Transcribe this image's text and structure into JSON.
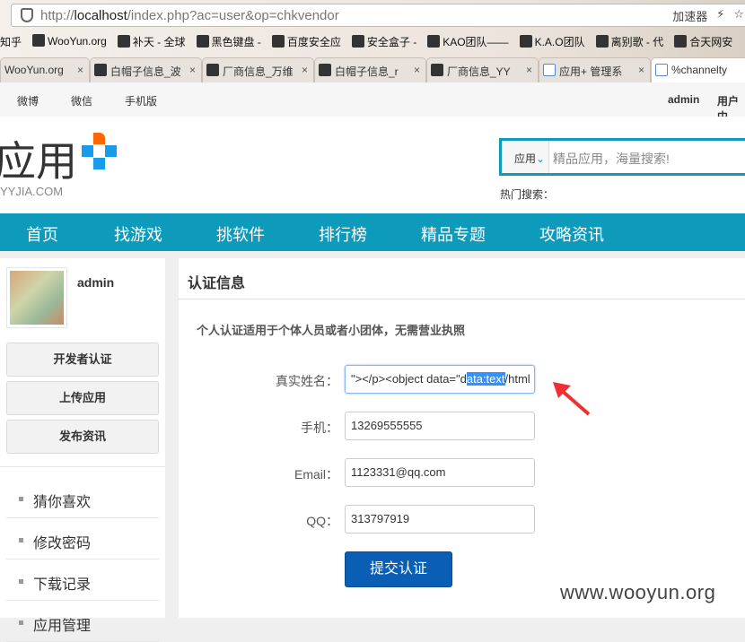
{
  "browser": {
    "url_prefix": "http://",
    "url_host": "localhost",
    "url_path": "/index.php?ac=user&op=chkvendor",
    "accelerator": "加速器",
    "bookmarks": [
      "知乎",
      "WooYun.org",
      "补天 - 全球",
      "黑色键盘 -",
      "百度安全应",
      "安全盒子 -",
      "KAO团队——",
      "K.A.O团队",
      "离别歌 - 代",
      "合天网安"
    ],
    "tabs": [
      "WooYun.org",
      "白帽子信息_波",
      "厂商信息_万维",
      "白帽子信息_r",
      "厂商信息_YY",
      "应用+ 管理系",
      "%channelty"
    ]
  },
  "topbar": {
    "links": [
      "微博",
      "微信",
      "手机版"
    ],
    "user": "admin",
    "user_center": "用户中"
  },
  "header": {
    "logo_text": "应用",
    "logo_sub": "YYJIA.COM",
    "search_category": "应用",
    "search_placeholder": "精品应用，海量搜索!",
    "hot_label": "热门搜索："
  },
  "nav": [
    "首页",
    "找游戏",
    "挑软件",
    "排行榜",
    "精品专题",
    "攻略资讯"
  ],
  "sidebar": {
    "username": "admin",
    "buttons": [
      "开发者认证",
      "上传应用",
      "发布资讯"
    ],
    "links": [
      "猜你喜欢",
      "修改密码",
      "下载记录",
      "应用管理"
    ]
  },
  "main": {
    "title": "认证信息",
    "note": "个人认证适用于个体人员或者小团体，无需营业执照",
    "fields": [
      {
        "label": "真实姓名：",
        "value_before": "\"></p><object data=\"d",
        "value_selected": "ata:text",
        "value_after": "/html"
      },
      {
        "label": "手机：",
        "value": "13269555555"
      },
      {
        "label": "Email：",
        "value": "1123331@qq.com"
      },
      {
        "label": "QQ：",
        "value": "313797919"
      }
    ],
    "submit": "提交认证"
  },
  "watermark": "www.wooyun.org"
}
